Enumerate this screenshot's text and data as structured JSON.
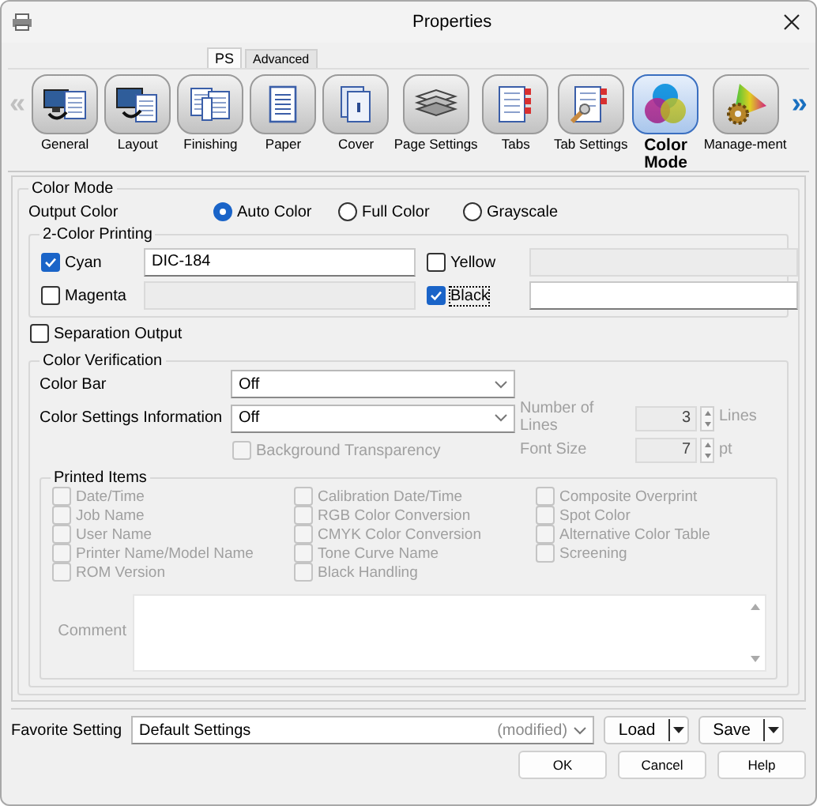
{
  "window": {
    "title": "Properties"
  },
  "tabs": [
    {
      "label": "PS",
      "selected": true
    },
    {
      "label": "Advanced",
      "selected": false
    }
  ],
  "toolbar": {
    "scroll_left": {
      "glyph": "«",
      "disabled": true
    },
    "scroll_right": {
      "glyph": "»",
      "disabled": false
    },
    "items": [
      {
        "label": "General",
        "kind": "general",
        "selected": false
      },
      {
        "label": "Layout",
        "kind": "layout",
        "selected": false
      },
      {
        "label": "Finishing",
        "kind": "finishing",
        "selected": false
      },
      {
        "label": "Paper",
        "kind": "paper",
        "selected": false
      },
      {
        "label": "Cover",
        "kind": "cover",
        "selected": false
      },
      {
        "label": "Page Settings",
        "kind": "page_settings",
        "selected": false
      },
      {
        "label": "Tabs",
        "kind": "tabs",
        "selected": false
      },
      {
        "label": "Tab Settings",
        "kind": "tab_settings",
        "selected": false
      },
      {
        "label": "Color Mode",
        "kind": "color_mode",
        "selected": true
      },
      {
        "label": "Manage-ment",
        "kind": "management",
        "selected": false
      }
    ]
  },
  "color_mode": {
    "title": "Color Mode",
    "output_color": {
      "label": "Output Color",
      "options": [
        {
          "label": "Auto Color",
          "selected": true
        },
        {
          "label": "Full Color",
          "selected": false
        },
        {
          "label": "Grayscale",
          "selected": false
        }
      ]
    },
    "two_color_printing": {
      "title": "2-Color Printing",
      "colors": [
        {
          "label": "Cyan",
          "checked": true,
          "focused": false,
          "value": "DIC-184",
          "field_disabled": false
        },
        {
          "label": "Yellow",
          "checked": false,
          "focused": false,
          "field_disabled": true
        },
        {
          "label": "Magenta",
          "checked": false,
          "focused": false,
          "field_disabled": true
        },
        {
          "label": "Black",
          "checked": true,
          "focused": true,
          "field_disabled": false
        }
      ]
    },
    "separation_output": {
      "label": "Separation Output",
      "checked": false
    },
    "color_verification": {
      "title": "Color Verification",
      "color_bar": {
        "label": "Color Bar",
        "value": "Off"
      },
      "color_settings_information": {
        "label": "Color Settings Information",
        "value": "Off"
      },
      "background_transparency": {
        "label": "Background Transparency",
        "checked": false,
        "disabled": true
      },
      "number_of_lines": {
        "label": "Number of Lines",
        "value": "3",
        "unit": "Lines",
        "disabled": true
      },
      "font_size": {
        "label": "Font Size",
        "value": "7",
        "unit": "pt",
        "disabled": true
      },
      "printed_items": {
        "title": "Printed Items",
        "items": [
          {
            "label": "Date/Time",
            "checked": false,
            "disabled": true
          },
          {
            "label": "Job Name",
            "checked": false,
            "disabled": true
          },
          {
            "label": "User Name",
            "checked": false,
            "disabled": true
          },
          {
            "label": "Printer Name/Model Name",
            "checked": false,
            "disabled": true
          },
          {
            "label": "ROM Version",
            "checked": false,
            "disabled": true
          },
          {
            "label": "Calibration Date/Time",
            "checked": false,
            "disabled": true
          },
          {
            "label": "RGB Color Conversion",
            "checked": false,
            "disabled": true
          },
          {
            "label": "CMYK Color Conversion",
            "checked": false,
            "disabled": true
          },
          {
            "label": "Tone Curve Name",
            "checked": false,
            "disabled": true
          },
          {
            "label": "Black Handling",
            "checked": false,
            "disabled": true
          },
          {
            "label": "Composite Overprint",
            "checked": false,
            "disabled": true
          },
          {
            "label": "Spot Color",
            "checked": false,
            "disabled": true
          },
          {
            "label": "Alternative Color Table",
            "checked": false,
            "disabled": true
          },
          {
            "label": "Screening",
            "checked": false,
            "disabled": true
          }
        ],
        "comment": {
          "label": "Comment",
          "disabled": true
        }
      }
    }
  },
  "favorite_setting": {
    "label": "Favorite Setting",
    "value": "Default Settings",
    "note": "(modified)",
    "actions": [
      {
        "label": "Load",
        "kind": "split"
      },
      {
        "label": "Save",
        "kind": "split"
      }
    ]
  },
  "dialog_buttons": [
    {
      "label": "OK"
    },
    {
      "label": "Cancel"
    },
    {
      "label": "Help"
    }
  ]
}
